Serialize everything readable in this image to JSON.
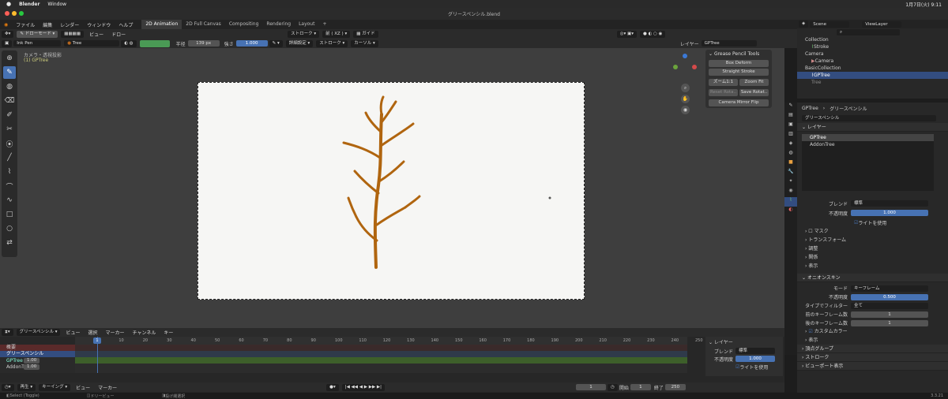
{
  "mac": {
    "app": "Blender",
    "menus": [
      "Window"
    ],
    "datetime": "1月7日(火) 9:11"
  },
  "title": "グリースペンシル.blend",
  "menubar": {
    "items": [
      "ファイル",
      "編集",
      "レンダー",
      "ウィンドウ",
      "ヘルプ"
    ],
    "tabs": [
      "2D Animation",
      "2D Full Canvas",
      "Compositing",
      "Rendering",
      "Layout"
    ],
    "add": "+"
  },
  "header": {
    "mode": "ドローモード",
    "view": "ビュー",
    "draw": "ドロー",
    "stroke": "ストローク",
    "axis": "前 ( XZ )",
    "guide": "ガイド"
  },
  "tooloptions": {
    "brush": "Ink Pen",
    "material": "Tree",
    "radius_label": "半径",
    "radius": "139 px",
    "strength_label": "強さ",
    "strength": "1.000",
    "advanced": "詳細設定",
    "stroke": "ストローク",
    "cursor": "カーソル",
    "layer_label": "レイヤー",
    "layer": "GPTree"
  },
  "viewport": {
    "camera_label": "カメラ・透視投影",
    "object_label": "(1) GPTree",
    "gp_panel": {
      "title": "Grease Pencil Tools",
      "buttons": [
        "Box Deform",
        "Straight Stroke",
        "Zoom Fit",
        "Reset Rota..",
        "Save Rotat..",
        "Camera Mirror Flip"
      ],
      "zoom": "ズーム1:1"
    }
  },
  "outliner": {
    "scene": "Scene",
    "viewlayer": "ViewLayer",
    "items": [
      "Collection",
      "Stroke",
      "Camera",
      "Camera",
      "BasicCollection",
      "GPTree",
      "Tree"
    ]
  },
  "props": {
    "breadcrumb_obj": "GPTree",
    "breadcrumb_data": "グリースペンシル",
    "datablock": "グリースペンシル",
    "layers_title": "レイヤー",
    "layers": [
      "GPTree",
      "AddonTree"
    ],
    "blend_label": "ブレンド",
    "blend": "標準",
    "opacity_label": "不透明度",
    "opacity": "1.000",
    "uselights": "ライトを使用",
    "sub_sections": [
      "マスク",
      "トランスフォーム",
      "調整",
      "関係",
      "表示"
    ],
    "onion_title": "オニオンスキン",
    "mode_label": "モード",
    "mode": "キーフレーム",
    "onion_opacity_label": "不透明度",
    "onion_opacity": "0.500",
    "filter_label": "タイプでフィルター",
    "filter": "全て",
    "before_label": "前のキーフレーム数",
    "before": "1",
    "after_label": "後のキーフレーム数",
    "after": "1",
    "onion_subs": [
      "カスタムカラー",
      "表示"
    ],
    "more": [
      "頂点グループ",
      "ストローク",
      "ビューポート表示"
    ],
    "tabs_label": "グリースペンシル"
  },
  "timeline": {
    "editor": "グリースペンシル",
    "menus": [
      "ビュー",
      "選択",
      "マーカー",
      "チャンネル",
      "キー"
    ],
    "frames": [
      "1",
      "10",
      "20",
      "30",
      "40",
      "50",
      "60",
      "70",
      "80",
      "90",
      "100",
      "110",
      "120",
      "130",
      "140",
      "150",
      "160",
      "170",
      "180",
      "190",
      "200",
      "210",
      "220",
      "230",
      "240",
      "250"
    ],
    "channels": [
      "概要",
      "グリースペンシル",
      "GPTree",
      "AddonTree"
    ],
    "opacity": "1.00",
    "layer_panel": {
      "title": "レイヤー",
      "blend_label": "ブレンド",
      "blend": "標準",
      "opacity_label": "不透明度",
      "opacity": "1.000",
      "uselights": "ライトを使用"
    },
    "play_label": "再生",
    "keying": "キーイング",
    "view": "ビュー",
    "marker": "マーカー",
    "current": "1",
    "start_label": "開始",
    "start": "1",
    "end_label": "終了",
    "end": "250"
  },
  "status": {
    "left": "Select (Toggle)",
    "mid": "ドリービュー",
    "right": "投げ縄選択",
    "version": "3.3.21"
  }
}
